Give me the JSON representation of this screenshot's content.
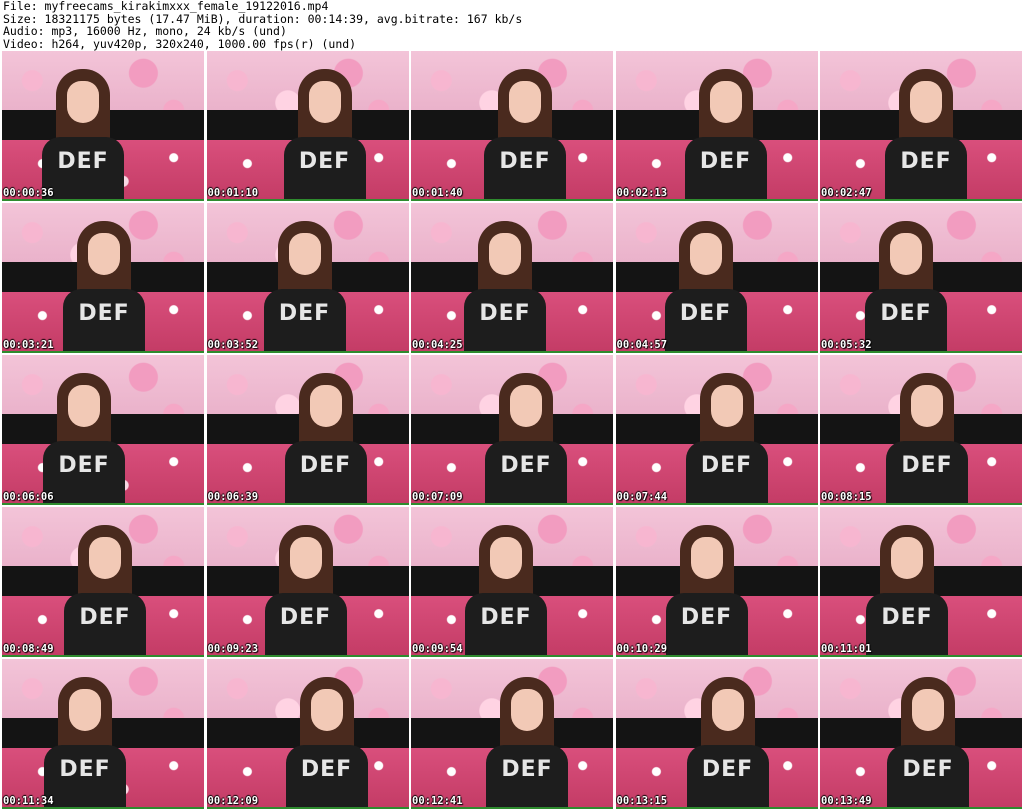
{
  "header": {
    "file": "File: myfreecams_kirakimxxx_female_19122016.mp4",
    "size": "Size: 18321175 bytes (17.47 MiB), duration: 00:14:39, avg.bitrate: 167 kb/s",
    "audio": "Audio: mp3, 16000 Hz, mono, 24 kb/s (und)",
    "video": "Video: h264, yuv420p, 320x240, 1000.00 fps(r) (und)"
  },
  "shirt_text": "DEF",
  "colors": {
    "timestamp_outline": "#000000",
    "thumb_border": "#2e8b2e"
  },
  "thumbnails": [
    {
      "timestamp": "00:00:36"
    },
    {
      "timestamp": "00:01:10"
    },
    {
      "timestamp": "00:01:40"
    },
    {
      "timestamp": "00:02:13"
    },
    {
      "timestamp": "00:02:47"
    },
    {
      "timestamp": "00:03:21"
    },
    {
      "timestamp": "00:03:52"
    },
    {
      "timestamp": "00:04:25"
    },
    {
      "timestamp": "00:04:57"
    },
    {
      "timestamp": "00:05:32"
    },
    {
      "timestamp": "00:06:06"
    },
    {
      "timestamp": "00:06:39"
    },
    {
      "timestamp": "00:07:09"
    },
    {
      "timestamp": "00:07:44"
    },
    {
      "timestamp": "00:08:15"
    },
    {
      "timestamp": "00:08:49"
    },
    {
      "timestamp": "00:09:23"
    },
    {
      "timestamp": "00:09:54"
    },
    {
      "timestamp": "00:10:29"
    },
    {
      "timestamp": "00:11:01"
    },
    {
      "timestamp": "00:11:34"
    },
    {
      "timestamp": "00:12:09"
    },
    {
      "timestamp": "00:12:41"
    },
    {
      "timestamp": "00:13:15"
    },
    {
      "timestamp": "00:13:49"
    }
  ]
}
